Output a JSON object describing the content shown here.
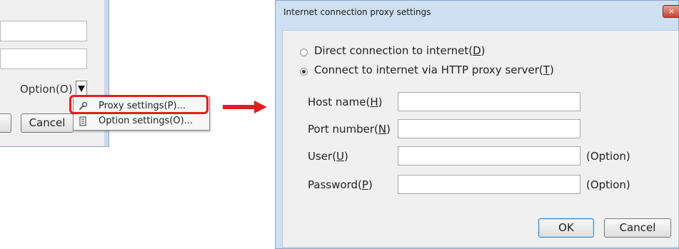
{
  "left_panel": {
    "option_label": "Option(O)",
    "cancel_label": "Cancel",
    "menu": {
      "items": [
        {
          "label": "Proxy settings(P)...",
          "icon": "wrench-icon"
        },
        {
          "label": "Option settings(O)...",
          "icon": "settings-icon"
        }
      ]
    }
  },
  "dialog": {
    "title": "Internet connection proxy settings",
    "close_label": "×",
    "radio_direct": {
      "prefix": "Direct connection to internet(",
      "key": "D",
      "suffix": ")",
      "selected": false
    },
    "radio_proxy": {
      "prefix": "Connect to internet via HTTP proxy server(",
      "key": "T",
      "suffix": ")",
      "selected": true
    },
    "fields": {
      "host": {
        "prefix": "Host name(",
        "key": "H",
        "suffix": ")",
        "value": ""
      },
      "port": {
        "prefix": "Port number(",
        "key": "N",
        "suffix": ")",
        "value": ""
      },
      "user": {
        "prefix": "User(",
        "key": "U",
        "suffix": ")",
        "value": "",
        "note": "(Option)"
      },
      "password": {
        "prefix": "Password(",
        "key": "P",
        "suffix": ")",
        "value": "",
        "note": "(Option)"
      }
    },
    "ok_label": "OK",
    "cancel_label": "Cancel"
  },
  "colors": {
    "highlight": "#e02020",
    "arrow": "#e02020"
  }
}
